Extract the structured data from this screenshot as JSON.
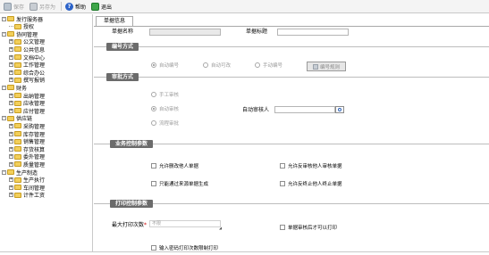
{
  "toolbar": {
    "save": "保存",
    "save_as": "另存为",
    "help": "帮助",
    "exit": "退出"
  },
  "tree": [
    {
      "label": "发行服务器",
      "level": 0,
      "expand": "-"
    },
    {
      "label": "授权",
      "level": 1,
      "expand": ""
    },
    {
      "label": "协同管理",
      "level": 0,
      "expand": "-"
    },
    {
      "label": "公文管理",
      "level": 1,
      "expand": "+"
    },
    {
      "label": "公共信息",
      "level": 1,
      "expand": "+"
    },
    {
      "label": "文档中心",
      "level": 1,
      "expand": "+"
    },
    {
      "label": "工作管理",
      "level": 1,
      "expand": "+"
    },
    {
      "label": "综合办公",
      "level": 1,
      "expand": "+"
    },
    {
      "label": "撰写报销",
      "level": 1,
      "expand": "+"
    },
    {
      "label": "财务",
      "level": 0,
      "expand": "-"
    },
    {
      "label": "出纳管理",
      "level": 1,
      "expand": "+"
    },
    {
      "label": "应收管理",
      "level": 1,
      "expand": "+"
    },
    {
      "label": "应付管理",
      "level": 1,
      "expand": "+"
    },
    {
      "label": "供应链",
      "level": 0,
      "expand": "-"
    },
    {
      "label": "采购管理",
      "level": 1,
      "expand": "+"
    },
    {
      "label": "库存管理",
      "level": 1,
      "expand": "+"
    },
    {
      "label": "销售管理",
      "level": 1,
      "expand": "+"
    },
    {
      "label": "存货核算",
      "level": 1,
      "expand": "+"
    },
    {
      "label": "委外管理",
      "level": 1,
      "expand": "+"
    },
    {
      "label": "质量管理",
      "level": 1,
      "expand": "+"
    },
    {
      "label": "生产制造",
      "level": 0,
      "expand": "-"
    },
    {
      "label": "生产执行",
      "level": 1,
      "expand": "+"
    },
    {
      "label": "车间管理",
      "level": 1,
      "expand": "+"
    },
    {
      "label": "计件工资",
      "level": 1,
      "expand": "+"
    }
  ],
  "main": {
    "tab": "单据信息",
    "doc_name_label": "单据名称",
    "doc_name_value": "",
    "doc_title_label": "单据标题",
    "doc_title_value": ""
  },
  "numbering": {
    "title": "编号方式",
    "options": [
      "自动编号",
      "自动可改",
      "手动编号"
    ],
    "selected": "自动编号",
    "rule_button": "编号规则"
  },
  "approval": {
    "title": "审批方式",
    "options": [
      "手工审核",
      "自动审核",
      "流程审批"
    ],
    "selected": "自动审核",
    "auditor_label": "自动审核人",
    "auditor_value": ""
  },
  "business": {
    "title": "业务控制参数",
    "options": [
      {
        "label": "允许删改他人单据",
        "checked": false
      },
      {
        "label": "允许反审核他人审核单据",
        "checked": false
      },
      {
        "label": "只能通过来源单据生成",
        "checked": false
      },
      {
        "label": "允许反终止他人终止单据",
        "checked": false
      }
    ]
  },
  "print": {
    "title": "打印控制参数",
    "max_print_label": "最大打印次数",
    "max_print_required": "*",
    "max_print_placeholder": "不限",
    "print_after_audit": "单据审核后才可以打印",
    "print_pwd": "输入密码打印次数限制打印"
  },
  "colors": {
    "section_title_bg": "#6b6b6b",
    "folder": "#f2cf5b",
    "help_icon": "#2c63c9",
    "exit_icon": "#3fa64a"
  }
}
